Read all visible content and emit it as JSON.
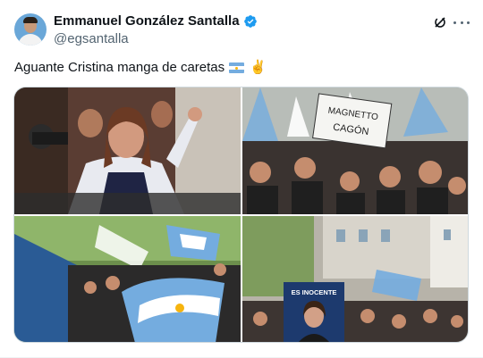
{
  "author": {
    "name": "Emmanuel González Santalla",
    "handle": "@egsantalla"
  },
  "post": {
    "text": "Aguante Cristina manga de caretas"
  },
  "icons": {
    "verified": "verified-badge-icon",
    "grok": "grok-icon",
    "more": "more-options-icon"
  },
  "colors": {
    "verified": "#1d9bf0",
    "muted": "#536471",
    "flag_blue": "#74acdf"
  },
  "media": {
    "photos": [
      {
        "sign_lines": []
      },
      {
        "sign_lines": [
          "MAGNETTO",
          "CAGÓN"
        ]
      },
      {
        "sign_lines": []
      },
      {
        "sign_lines": [
          "ES INOCENTE"
        ]
      }
    ]
  }
}
